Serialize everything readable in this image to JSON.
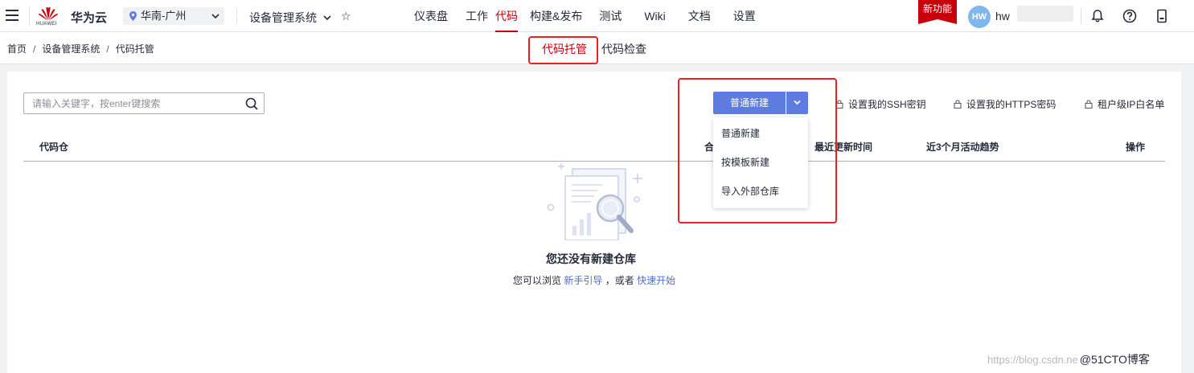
{
  "topbar": {
    "brand_logo_text": "HUAWEI",
    "brand_name": "华为云",
    "region": "华南-广州",
    "project": "设备管理系统",
    "nav": [
      {
        "label": "仪表盘",
        "active": false
      },
      {
        "label": "工作",
        "active": false
      },
      {
        "label": "代码",
        "active": true
      },
      {
        "label": "构建&发布",
        "active": false
      },
      {
        "label": "测试",
        "active": false
      },
      {
        "label": "Wiki",
        "active": false
      },
      {
        "label": "文档",
        "active": false
      },
      {
        "label": "设置",
        "active": false
      }
    ],
    "new_feature_badge": "新功能",
    "avatar_initials": "HW",
    "username": "hw"
  },
  "breadcrumb": {
    "items": [
      "首页",
      "设备管理系统",
      "代码托管"
    ],
    "separator": "/"
  },
  "subtabs": [
    {
      "label": "代码托管",
      "active": true
    },
    {
      "label": "代码检查",
      "active": false
    }
  ],
  "toolbar": {
    "search_placeholder": "请输入关键字，按enter键搜索",
    "new_button": "普通新建",
    "ssh_key": "设置我的SSH密钥",
    "https_password": "设置我的HTTPS密码",
    "ip_whitelist": "租户级IP白名单"
  },
  "dropdown_menu": {
    "items": [
      "普通新建",
      "按模板新建",
      "导入外部仓库"
    ]
  },
  "table": {
    "columns": {
      "repo": "代码仓",
      "partial_hidden": "合",
      "updated": "最近更新时间",
      "trend": "近3个月活动趋势",
      "actions": "操作"
    }
  },
  "empty_state": {
    "title": "您还没有新建仓库",
    "text_before": "您可以浏览",
    "link_guide": "新手引导",
    "text_middle": "，或者",
    "link_quickstart": "快速开始"
  },
  "watermark": {
    "url": "https://blog.csdn.ne",
    "site": "@51CTO博客"
  },
  "colors": {
    "brand_red": "#c7000b",
    "primary_button": "#5e7ce0",
    "annotation_red": "#e62222",
    "link_blue": "#526ecc",
    "avatar_blue": "#7fb6ee"
  }
}
